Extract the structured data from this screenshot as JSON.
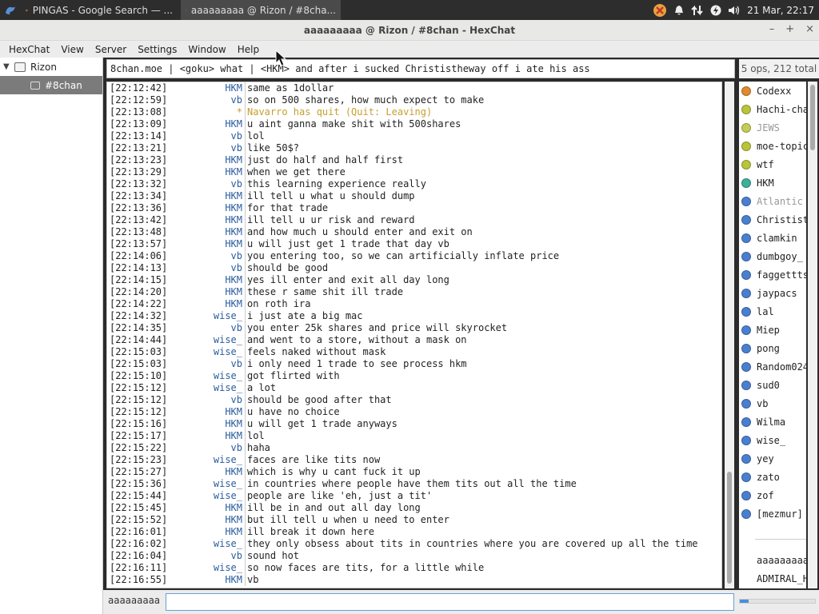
{
  "taskbar": {
    "task1_label": "PINGAS - Google Search — ...",
    "task2_label": "aaaaaaaaa @ Rizon / #8cha...",
    "clock": "21 Mar, 22:17"
  },
  "window": {
    "title": "aaaaaaaaa @ Rizon / #8chan - HexChat"
  },
  "menu": [
    "HexChat",
    "View",
    "Server",
    "Settings",
    "Window",
    "Help"
  ],
  "tree": {
    "server": "Rizon",
    "channel": "#8chan"
  },
  "topic": "8chan.moe | <goku> what | <HKM> and after i sucked Christistheway off i ate his ass",
  "user_count": "5 ops, 212 total",
  "messages": [
    {
      "ts": "[22:12:42]",
      "nick": "HKM",
      "text": "same as 1dollar"
    },
    {
      "ts": "[22:12:59]",
      "nick": "vb",
      "text": "so on 500 shares, how much expect to make"
    },
    {
      "ts": "[22:13:08]",
      "nick": "*",
      "text": "Navarro has quit (Quit: Leaving)",
      "action": true
    },
    {
      "ts": "[22:13:09]",
      "nick": "HKM",
      "text": "u aint ganna make shit with 500shares"
    },
    {
      "ts": "[22:13:14]",
      "nick": "vb",
      "text": "lol"
    },
    {
      "ts": "[22:13:21]",
      "nick": "vb",
      "text": "like 50$?"
    },
    {
      "ts": "[22:13:23]",
      "nick": "HKM",
      "text": "just do half and half first"
    },
    {
      "ts": "[22:13:29]",
      "nick": "HKM",
      "text": "when we get there"
    },
    {
      "ts": "[22:13:32]",
      "nick": "vb",
      "text": "this learning experience really"
    },
    {
      "ts": "[22:13:34]",
      "nick": "HKM",
      "text": "ill tell u what u should dump"
    },
    {
      "ts": "[22:13:36]",
      "nick": "HKM",
      "text": "for that trade"
    },
    {
      "ts": "[22:13:42]",
      "nick": "HKM",
      "text": "ill tell u ur risk and reward"
    },
    {
      "ts": "[22:13:48]",
      "nick": "HKM",
      "text": "and how much u should enter and exit on"
    },
    {
      "ts": "[22:13:57]",
      "nick": "HKM",
      "text": "u will just get 1 trade that day vb"
    },
    {
      "ts": "[22:14:06]",
      "nick": "vb",
      "text": "you entering too, so we can artificially inflate price"
    },
    {
      "ts": "[22:14:13]",
      "nick": "vb",
      "text": "should be good"
    },
    {
      "ts": "[22:14:15]",
      "nick": "HKM",
      "text": "yes ill enter and exit all day long"
    },
    {
      "ts": "[22:14:20]",
      "nick": "HKM",
      "text": "these r same shit ill trade"
    },
    {
      "ts": "[22:14:22]",
      "nick": "HKM",
      "text": "on roth ira"
    },
    {
      "ts": "[22:14:32]",
      "nick": "wise_",
      "text": "i just ate a big mac"
    },
    {
      "ts": "[22:14:35]",
      "nick": "vb",
      "text": "you enter 25k shares and price will skyrocket"
    },
    {
      "ts": "[22:14:44]",
      "nick": "wise_",
      "text": "and went to a store, without a mask on"
    },
    {
      "ts": "[22:15:03]",
      "nick": "wise_",
      "text": "feels naked without mask"
    },
    {
      "ts": "[22:15:03]",
      "nick": "vb",
      "text": "i only need 1 trade to see process hkm"
    },
    {
      "ts": "[22:15:10]",
      "nick": "wise_",
      "text": "got flirted with"
    },
    {
      "ts": "[22:15:12]",
      "nick": "wise_",
      "text": "a lot"
    },
    {
      "ts": "[22:15:12]",
      "nick": "vb",
      "text": "should be good after that"
    },
    {
      "ts": "[22:15:12]",
      "nick": "HKM",
      "text": "u have no choice"
    },
    {
      "ts": "[22:15:16]",
      "nick": "HKM",
      "text": "u will get 1 trade anyways"
    },
    {
      "ts": "[22:15:17]",
      "nick": "HKM",
      "text": "lol"
    },
    {
      "ts": "[22:15:22]",
      "nick": "vb",
      "text": "haha"
    },
    {
      "ts": "[22:15:23]",
      "nick": "wise_",
      "text": "faces are like tits now"
    },
    {
      "ts": "[22:15:27]",
      "nick": "HKM",
      "text": "which is why u cant fuck it up"
    },
    {
      "ts": "[22:15:36]",
      "nick": "wise_",
      "text": "in countries where people have them tits out all the time"
    },
    {
      "ts": "[22:15:44]",
      "nick": "wise_",
      "text": "people are like 'eh, just a tit'"
    },
    {
      "ts": "[22:15:45]",
      "nick": "HKM",
      "text": "ill be in and out all day long"
    },
    {
      "ts": "[22:15:52]",
      "nick": "HKM",
      "text": "but ill tell u when u need to enter"
    },
    {
      "ts": "[22:16:01]",
      "nick": "HKM",
      "text": "ill break it down here"
    },
    {
      "ts": "[22:16:02]",
      "nick": "wise_",
      "text": "they only obsess about tits in countries where you are covered up all the time"
    },
    {
      "ts": "[22:16:04]",
      "nick": "vb",
      "text": "sound hot"
    },
    {
      "ts": "[22:16:11]",
      "nick": "wise_",
      "text": "so now faces are tits, for a little while"
    },
    {
      "ts": "[22:16:55]",
      "nick": "HKM",
      "text": "vb"
    }
  ],
  "users": [
    {
      "name": "Codexx",
      "color": "#e08a2e"
    },
    {
      "name": "Hachi-cha",
      "color": "#b8c43a"
    },
    {
      "name": "JEWS",
      "color": "#c3cc5a",
      "away": true
    },
    {
      "name": "moe-topic",
      "color": "#b8c43a"
    },
    {
      "name": "wtf",
      "color": "#b8c43a"
    },
    {
      "name": "HKM",
      "color": "#3fae9a"
    },
    {
      "name": "Atlantic",
      "color": "#4a7fd0",
      "away": true
    },
    {
      "name": "Christist",
      "color": "#4a7fd0"
    },
    {
      "name": "clamkin",
      "color": "#4a7fd0"
    },
    {
      "name": "dumbgoy_",
      "color": "#4a7fd0"
    },
    {
      "name": "faggettts",
      "color": "#4a7fd0"
    },
    {
      "name": "jaypacs",
      "color": "#4a7fd0"
    },
    {
      "name": "lal",
      "color": "#4a7fd0"
    },
    {
      "name": "Miep",
      "color": "#4a7fd0"
    },
    {
      "name": "pong",
      "color": "#4a7fd0"
    },
    {
      "name": "Random024",
      "color": "#4a7fd0"
    },
    {
      "name": "sud0",
      "color": "#4a7fd0"
    },
    {
      "name": "vb",
      "color": "#4a7fd0"
    },
    {
      "name": "Wilma",
      "color": "#4a7fd0"
    },
    {
      "name": "wise_",
      "color": "#4a7fd0"
    },
    {
      "name": "yey",
      "color": "#4a7fd0"
    },
    {
      "name": "zato",
      "color": "#4a7fd0"
    },
    {
      "name": "zof",
      "color": "#4a7fd0"
    },
    {
      "name": "[mezmur]",
      "color": "#4a7fd0"
    }
  ],
  "user_sub": [
    "aaaaaaaaa",
    "ADMIRAL_H"
  ],
  "input": {
    "nick": "aaaaaaaaa",
    "value": ""
  },
  "lag_fraction": 0.12
}
